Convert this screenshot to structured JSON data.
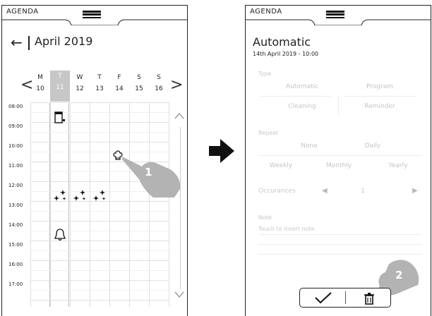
{
  "left_panel": {
    "tab_title": "AGENDA",
    "month_title": "April 2019",
    "back_glyph": "←",
    "prev_glyph": "<",
    "next_glyph": ">",
    "days": [
      {
        "letter": "M",
        "num": "10"
      },
      {
        "letter": "T",
        "num": "11"
      },
      {
        "letter": "W",
        "num": "12"
      },
      {
        "letter": "T",
        "num": "13"
      },
      {
        "letter": "F",
        "num": "14"
      },
      {
        "letter": "S",
        "num": "15"
      },
      {
        "letter": "S",
        "num": "16"
      }
    ],
    "selected_day_index": 1,
    "times": [
      "08:00",
      "09:00",
      "10:00",
      "11:00",
      "12:00",
      "13:00",
      "14:00",
      "15:00",
      "16:00",
      "17:00"
    ],
    "events": [
      {
        "type": "cooking-program-icon",
        "day": "T 11",
        "time": "08:00"
      },
      {
        "type": "chef-hat-icon",
        "day": "S 15",
        "time": "10:00"
      },
      {
        "type": "sparkles-icon",
        "day": "M 10",
        "time": "12:00"
      },
      {
        "type": "sparkles-icon",
        "day": "T 11",
        "time": "12:00"
      },
      {
        "type": "sparkles-icon",
        "day": "W 12",
        "time": "12:00"
      },
      {
        "type": "bell-icon",
        "day": "M 10",
        "time": "14:00"
      }
    ],
    "callout_number": "1"
  },
  "right_panel": {
    "tab_title": "AGENDA",
    "title": "Automatic",
    "subtitle": "14th April 2019 - 10:00",
    "type_label": "Type",
    "type_options": [
      "Automatic",
      "Program",
      "Cleaning",
      "Reminder"
    ],
    "repeat_label": "Repeat",
    "repeat_options": [
      "None",
      "Daily",
      "Weekly",
      "Monthly",
      "Yearly"
    ],
    "occurrences_label": "Occurances",
    "occurrences_value": "1",
    "note_label": "Note",
    "note_placeholder": "Touch to insert note.",
    "callout_number": "2"
  },
  "icons": {
    "menu": "hamburger-menu-icon",
    "transition": "right-arrow-icon",
    "confirm": "checkmark-icon",
    "delete": "trash-icon"
  },
  "colors": {
    "ink": "#222222",
    "selected_day": "#c7c7c7",
    "disabled_text": "#c4c4c4",
    "hand": "#b3b3b3"
  }
}
